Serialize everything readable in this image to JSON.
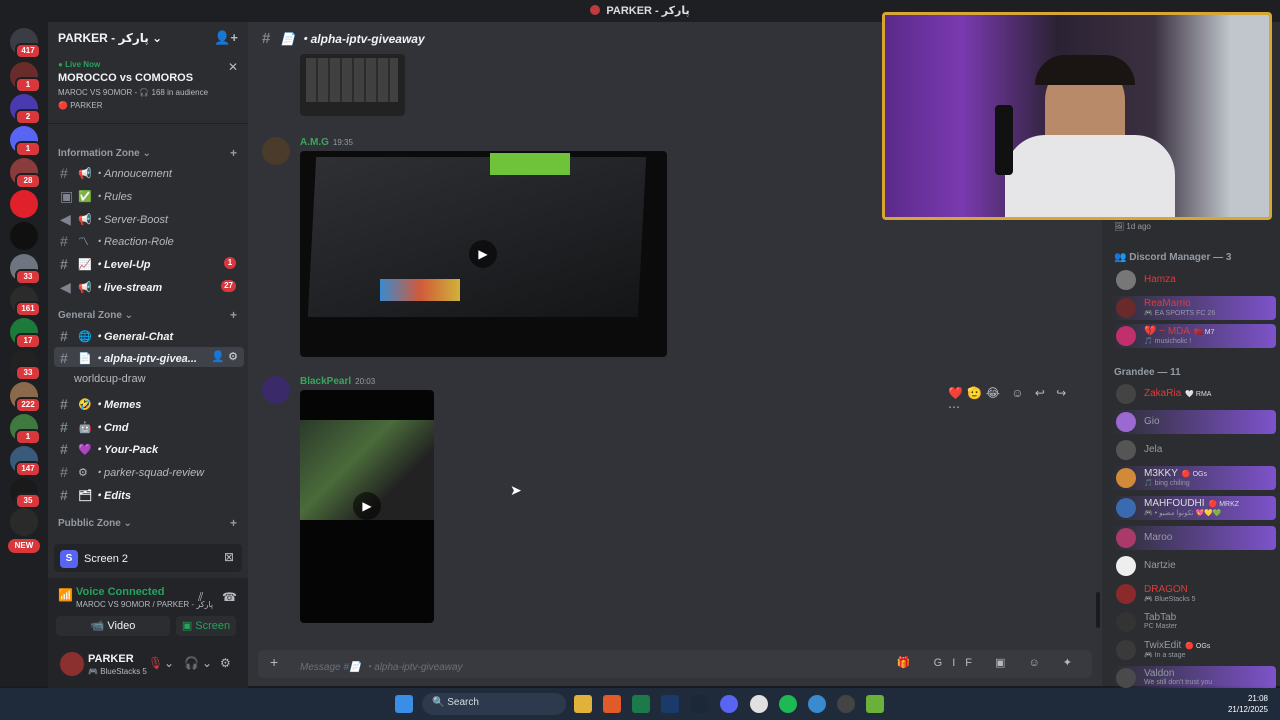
{
  "window": {
    "title": "PARKER - پاركر"
  },
  "servers": [
    {
      "badge": "417"
    },
    {
      "badge": "1"
    },
    {
      "badge": "2"
    },
    {
      "badge": "1"
    },
    {
      "badge": "28"
    },
    {
      "badge": ""
    },
    {
      "badge": ""
    },
    {
      "badge": "33"
    },
    {
      "badge": "161"
    },
    {
      "badge": "17"
    },
    {
      "badge": "33"
    },
    {
      "badge": "222"
    },
    {
      "badge": "1"
    },
    {
      "badge": "147"
    },
    {
      "badge": "35"
    }
  ],
  "new_label": "NEW",
  "guild": {
    "name": "PARKER - پاركر"
  },
  "live": {
    "tag": "Live Now",
    "title": "MOROCCO vs COMOROS",
    "subtitle": "MAROC VS 9OMOR - 🎧 168 in audience",
    "host": "PARKER"
  },
  "categories": {
    "info": "Information Zone",
    "general": "General Zone",
    "public": "Pubblic Zone"
  },
  "channels": [
    {
      "icon": "📢",
      "name": "・Annoucement",
      "count": ""
    },
    {
      "icon": "✅",
      "name": "・Rules",
      "count": ""
    },
    {
      "icon": "📢",
      "name": "・Server-Boost",
      "count": ""
    },
    {
      "icon": "〽",
      "name": "・Reaction-Role",
      "count": ""
    },
    {
      "icon": "📈",
      "name": "・Level-Up",
      "count": "1"
    },
    {
      "icon": "📢",
      "name": "・live-stream",
      "count": "27"
    },
    {
      "icon": "🌐",
      "name": "・General-Chat",
      "count": ""
    },
    {
      "icon": "📄",
      "name": "・alpha-iptv-giveа...",
      "count": ""
    },
    {
      "icon": "",
      "name": "worldcup-draw",
      "count": ""
    },
    {
      "icon": "🤣",
      "name": "・Memes",
      "count": ""
    },
    {
      "icon": "🤖",
      "name": "・Cmd",
      "count": ""
    },
    {
      "icon": "💜",
      "name": "・Your-Pack",
      "count": ""
    },
    {
      "icon": "⚙",
      "name": "・parker-squad-review",
      "count": ""
    },
    {
      "icon": "🗂",
      "name": "・Edits",
      "count": ""
    }
  ],
  "screen_share": {
    "label": "Screen 2",
    "icon_letter": "S"
  },
  "voice": {
    "status": "Voice Connected",
    "location": "MAROC VS 9OMOR / PARKER - پاركر",
    "video_label": "Video",
    "screen_label": "Screen"
  },
  "user": {
    "name": "PARKER",
    "status": "BlueStacks 5"
  },
  "channel_header": {
    "name": "📄 ・alpha-iptv-giveaway"
  },
  "messages": [
    {
      "author": "A.M.G",
      "time": "19:35",
      "color": "#3ba55d"
    },
    {
      "author": "BlackPearl",
      "time": "20:03",
      "color": "#3ba55d"
    }
  ],
  "reactions": "❤️🫡😂",
  "composer": {
    "placeholder": "Message #📄 ・alpha-iptv-giveaway"
  },
  "member_list": {
    "ago": "1d ago",
    "groups": [
      {
        "title": "Discord Manager — 3",
        "members": [
          {
            "name": "Hamza",
            "status": "",
            "tag": "",
            "color": "#e03a3a"
          },
          {
            "name": "ReaMarrio",
            "status": "🎮 EA SPORTS FC 26",
            "tag": "",
            "color": "#e03a3a"
          },
          {
            "name": "💔 ~ MDA",
            "status": "🎵 musicholic !",
            "tag": "🇲🇦 M7",
            "color": "#e03a3a"
          }
        ]
      },
      {
        "title": "Grandee — 11",
        "members": [
          {
            "name": "ZakaRia",
            "status": "",
            "tag": "🤍 RMA",
            "color": "#e03a3a"
          },
          {
            "name": "Gio",
            "status": "",
            "tag": "",
            "color": "#949ba4"
          },
          {
            "name": "Jela",
            "status": "",
            "tag": "",
            "color": "#949ba4"
          },
          {
            "name": "M3KKY",
            "status": "🎵 bing chiling",
            "tag": "🔴 OGs",
            "color": "#949ba4"
          },
          {
            "name": "MAHFOUDHI",
            "status": "🎮 • تكونوا مضيو 💖💛💚",
            "tag": "🔴 MRKZ",
            "color": "#949ba4"
          },
          {
            "name": "Maroo",
            "status": "",
            "tag": "",
            "color": "#949ba4"
          },
          {
            "name": "Nartzie",
            "status": "",
            "tag": "",
            "color": "#949ba4"
          },
          {
            "name": "DRAGON",
            "status": "🎮 BlueStacks 5",
            "tag": "",
            "color": "#e03a3a"
          },
          {
            "name": "TabTab",
            "status": "PC Master",
            "tag": "",
            "color": "#949ba4"
          },
          {
            "name": "TwixEdit",
            "status": "🎮 In a stage",
            "tag": "🔴 OGs",
            "color": "#949ba4"
          },
          {
            "name": "Valdon",
            "status": "We still don't trust you",
            "tag": "",
            "color": "#949ba4"
          }
        ]
      }
    ]
  },
  "taskbar": {
    "search": "Search",
    "time": "21:08",
    "date": "21/12/2025"
  }
}
